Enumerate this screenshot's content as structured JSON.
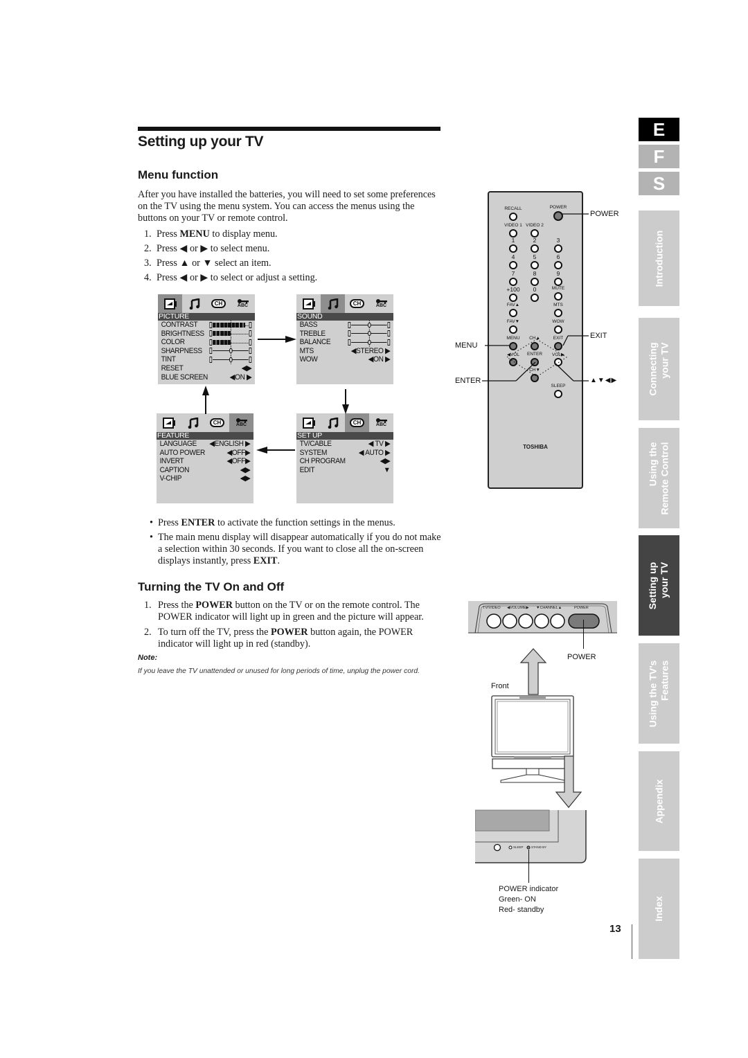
{
  "header": {
    "page_title": "Setting up your TV",
    "menu_section_title": "Menu function"
  },
  "intro": "After you have installed the batteries, you will need to set some preferences on the TV using the menu system. You can access the menus using the buttons on your TV or remote control.",
  "menu_steps": [
    {
      "num": "1.",
      "pre": "Press ",
      "bold": "MENU",
      "post": " to display menu."
    },
    {
      "num": "2.",
      "pre": "Press ◀ or ▶ to select menu.",
      "bold": "",
      "post": ""
    },
    {
      "num": "3.",
      "pre": "Press ▲ or ▼ select an item.",
      "bold": "",
      "post": ""
    },
    {
      "num": "4.",
      "pre": "Press ◀ or ▶ to select or adjust a setting.",
      "bold": "",
      "post": ""
    }
  ],
  "osd_tabs": {
    "picture_icon": "picture-icon",
    "sound_icon": "music-note-icon",
    "channel_label": "CH",
    "feature_label": "ABC"
  },
  "osd_menus": {
    "picture": {
      "header": "PICTURE",
      "rows": [
        {
          "label": "CONTRAST",
          "type": "bar",
          "level": 0.9
        },
        {
          "label": "BRIGHTNESS",
          "type": "bar",
          "level": 0.5
        },
        {
          "label": "COLOR",
          "type": "bar",
          "level": 0.5
        },
        {
          "label": "SHARPNESS",
          "type": "slider",
          "level": 0.5
        },
        {
          "label": "TINT",
          "type": "slider",
          "level": 0.5
        },
        {
          "label": "RESET",
          "type": "arrows",
          "value": "◀▶"
        },
        {
          "label": "BLUE SCREEN",
          "type": "value",
          "value": "◀ON ▶"
        }
      ]
    },
    "sound": {
      "header": "SOUND",
      "rows": [
        {
          "label": "BASS",
          "type": "slider",
          "level": 0.5
        },
        {
          "label": "TREBLE",
          "type": "slider",
          "level": 0.5
        },
        {
          "label": "BALANCE",
          "type": "slider",
          "level": 0.5
        },
        {
          "label": "MTS",
          "type": "value",
          "value": "◀STEREO ▶"
        },
        {
          "label": "WOW",
          "type": "value",
          "value": "◀ON ▶"
        }
      ]
    },
    "feature": {
      "header": "FEATURE",
      "rows": [
        {
          "label": "LANGUAGE",
          "type": "value",
          "value": "◀ENGLISH ▶"
        },
        {
          "label": "AUTO POWER",
          "type": "value",
          "value": "◀OFF▶"
        },
        {
          "label": "INVERT",
          "type": "value",
          "value": "◀OFF▶"
        },
        {
          "label": "CAPTION",
          "type": "arrows",
          "value": "◀▶"
        },
        {
          "label": "V-CHIP",
          "type": "arrows",
          "value": "◀▶"
        }
      ]
    },
    "setup": {
      "header": "SET UP",
      "rows": [
        {
          "label": "TV/CABLE",
          "type": "value",
          "value": "◀ TV ▶"
        },
        {
          "label": "SYSTEM",
          "type": "value",
          "value": "◀ AUTO ▶"
        },
        {
          "label": "CH PROGRAM",
          "type": "arrows",
          "value": "◀▶"
        },
        {
          "label": "EDIT",
          "type": "value",
          "value": "▼"
        }
      ]
    }
  },
  "bullets": [
    {
      "pre": "Press ",
      "bold": "ENTER",
      "post": " to activate the function settings in the menus."
    },
    {
      "pre": "The main menu display will disappear automatically if you do not make a selection within 30 seconds. If you want to close all the on-screen displays instantly, press ",
      "bold": "EXIT",
      "post": "."
    }
  ],
  "turning": {
    "title": "Turning the TV On and Off",
    "steps": [
      {
        "num": "1.",
        "pre": "Press the ",
        "bold": "POWER",
        "post": " button on the TV or on the remote control. The POWER indicator will light up in green and the picture will appear."
      },
      {
        "num": "2.",
        "pre": "To turn off the TV, press the ",
        "bold": "POWER",
        "post": " button again, the POWER indicator will light up in red (standby)."
      }
    ],
    "note_label": "Note:",
    "note_text": "If you leave the TV unattended or unused for long periods of time, unplug the power cord."
  },
  "remote": {
    "brand": "TOSHIBA",
    "buttons": {
      "recall": "RECALL",
      "power": "POWER",
      "video1": "VIDEO 1",
      "video2": "VIDEO 2",
      "n1": "1",
      "n2": "2",
      "n3": "3",
      "n4": "4",
      "n5": "5",
      "n6": "6",
      "n7": "7",
      "n8": "8",
      "n9": "9",
      "plus100": "+100",
      "n0": "0",
      "mute": "MUTE",
      "fav_up": "FAV▲",
      "mts": "MTS",
      "fav_down": "FAV▼",
      "wow": "WOW",
      "menu": "MENU",
      "ch_up": "CH▲",
      "exit": "EXIT",
      "vol_down": "◀VOL",
      "enter": "ENTER",
      "vol_up": "VOL▶",
      "ch_down": "CH▼",
      "sleep": "SLEEP"
    },
    "callouts": {
      "power": "POWER",
      "exit": "EXIT",
      "menu": "MENU",
      "enter": "ENTER",
      "arrows": "▲▼◀▶"
    }
  },
  "tv_panel": {
    "labels": {
      "tv_video": "TV/VIDEO",
      "volume": "◀VOLUME▶",
      "channel": "▼CHANNEL▲",
      "power": "POWER"
    },
    "power_callout": "POWER",
    "front_label": "Front",
    "sleep_label": "SLEEP",
    "standby_label": "STAND BY",
    "indicator_caption": [
      "POWER indicator",
      "Green- ON",
      "Red- standby"
    ]
  },
  "side_tabs": {
    "languages": [
      {
        "letter": "E",
        "active": true
      },
      {
        "letter": "F",
        "active": false
      },
      {
        "letter": "S",
        "active": false
      }
    ],
    "sections": [
      {
        "lines": [
          "Introduction"
        ],
        "active": false
      },
      {
        "lines": [
          "Connecting",
          "your TV"
        ],
        "active": false
      },
      {
        "lines": [
          "Using the",
          "Remote Control"
        ],
        "active": false
      },
      {
        "lines": [
          "Setting up",
          "your TV"
        ],
        "active": true
      },
      {
        "lines": [
          "Using the TV's",
          "Features"
        ],
        "active": false
      },
      {
        "lines": [
          "Appendix"
        ],
        "active": false
      },
      {
        "lines": [
          "Index"
        ],
        "active": false
      }
    ]
  },
  "page_number": "13"
}
